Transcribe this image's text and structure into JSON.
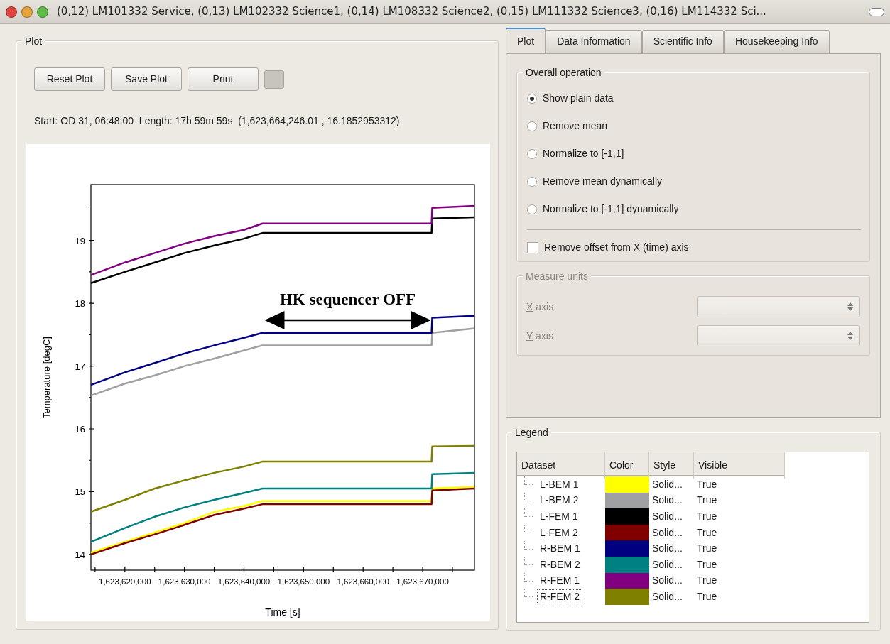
{
  "window": {
    "title": "(0,12) LM101332 Service, (0,13) LM102332 Science1, (0,14) LM108332 Science2, (0,15) LM111332 Science3, (0,16) LM114332 Sci..."
  },
  "plot_group": {
    "title": "Plot",
    "buttons": [
      "Reset Plot",
      "Save Plot",
      "Print"
    ],
    "info": "Start: OD 31, 06:48:00  Length: 17h 59m 59s  (1,623,664,246.01 , 16.1852953312)",
    "chart_data": {
      "type": "line",
      "xlabel": "Time [s]",
      "ylabel": "Temperature [degC]",
      "x": [
        1623614300,
        1623620000,
        1623625000,
        1623630000,
        1623635000,
        1623640000,
        1623643100,
        1623671500,
        1623671600,
        1623678700
      ],
      "series": [
        {
          "color": "#ffff00",
          "values": [
            14.03,
            14.2,
            14.35,
            14.5,
            14.68,
            14.77,
            14.85,
            14.85,
            15.05,
            15.08
          ]
        },
        {
          "color": "#a0a0a4",
          "values": [
            16.53,
            16.72,
            16.85,
            17.0,
            17.12,
            17.25,
            17.33,
            17.33,
            17.53,
            17.6
          ]
        },
        {
          "color": "#000000",
          "values": [
            18.32,
            18.5,
            18.65,
            18.8,
            18.92,
            19.03,
            19.12,
            19.12,
            19.35,
            19.37
          ]
        },
        {
          "color": "#800000",
          "values": [
            14.0,
            14.18,
            14.32,
            14.47,
            14.63,
            14.73,
            14.8,
            14.8,
            15.02,
            15.05
          ]
        },
        {
          "color": "#000080",
          "values": [
            16.7,
            16.9,
            17.05,
            17.2,
            17.33,
            17.45,
            17.53,
            17.53,
            17.77,
            17.8
          ]
        },
        {
          "color": "#008080",
          "values": [
            14.2,
            14.42,
            14.6,
            14.75,
            14.87,
            14.98,
            15.05,
            15.05,
            15.28,
            15.3
          ]
        },
        {
          "color": "#800080",
          "values": [
            18.45,
            18.65,
            18.8,
            18.95,
            19.07,
            19.17,
            19.27,
            19.27,
            19.52,
            19.55
          ]
        },
        {
          "color": "#808000",
          "values": [
            14.68,
            14.87,
            15.05,
            15.18,
            15.3,
            15.4,
            15.48,
            15.48,
            15.72,
            15.73
          ]
        }
      ],
      "xlim": [
        1623614300,
        1623678700
      ],
      "ylim": [
        13.75,
        19.89
      ],
      "xticks": [
        {
          "value": 1623620000,
          "label": "1,623,620,000"
        },
        {
          "value": 1623630000,
          "label": "1,623,630,000"
        },
        {
          "value": 1623640000,
          "label": "1,623,640,000"
        },
        {
          "value": 1623650000,
          "label": "1,623,650,000"
        },
        {
          "value": 1623660000,
          "label": "1,623,660,000"
        },
        {
          "value": 1623670000,
          "label": "1,623,670,000"
        }
      ],
      "yticks": [
        14,
        15,
        16,
        17,
        18,
        19
      ],
      "annotations": [
        "HK sequencer OFF"
      ]
    }
  },
  "tabs": [
    {
      "label": "Plot",
      "selected": true
    },
    {
      "label": "Data Information",
      "selected": false
    },
    {
      "label": "Scientific Info",
      "selected": false
    },
    {
      "label": "Housekeeping Info",
      "selected": false
    }
  ],
  "overall_operation": {
    "title": "Overall operation",
    "options": [
      {
        "label": "Show plain data",
        "selected": true
      },
      {
        "label": "Remove mean",
        "selected": false
      },
      {
        "label": "Normalize to [-1,1]",
        "selected": false
      },
      {
        "label": "Remove mean dynamically",
        "selected": false
      },
      {
        "label": "Normalize to [-1,1] dynamically",
        "selected": false
      }
    ],
    "checkbox": {
      "label": "Remove offset from X (time) axis",
      "checked": false
    }
  },
  "measure_units": {
    "title": "Measure units",
    "disabled": true,
    "fields": [
      {
        "label": "X axis"
      },
      {
        "label": "Y axis"
      }
    ]
  },
  "legend": {
    "title": "Legend",
    "columns": [
      "Dataset",
      "Color",
      "Style",
      "Visible"
    ],
    "rows": [
      {
        "dataset": "L-BEM 1",
        "color": "#ffff00",
        "style": "Solid...",
        "visible": "True",
        "focused": false
      },
      {
        "dataset": "L-BEM 2",
        "color": "#a0a0a4",
        "style": "Solid...",
        "visible": "True",
        "focused": false
      },
      {
        "dataset": "L-FEM 1",
        "color": "#000000",
        "style": "Solid...",
        "visible": "True",
        "focused": false
      },
      {
        "dataset": "L-FEM 2",
        "color": "#800000",
        "style": "Solid...",
        "visible": "True",
        "focused": false
      },
      {
        "dataset": "R-BEM 1",
        "color": "#000080",
        "style": "Solid...",
        "visible": "True",
        "focused": false
      },
      {
        "dataset": "R-BEM 2",
        "color": "#008080",
        "style": "Solid...",
        "visible": "True",
        "focused": false
      },
      {
        "dataset": "R-FEM 1",
        "color": "#800080",
        "style": "Solid...",
        "visible": "True",
        "focused": false
      },
      {
        "dataset": "R-FEM 2",
        "color": "#808000",
        "style": "Solid...",
        "visible": "True",
        "focused": true
      }
    ]
  }
}
